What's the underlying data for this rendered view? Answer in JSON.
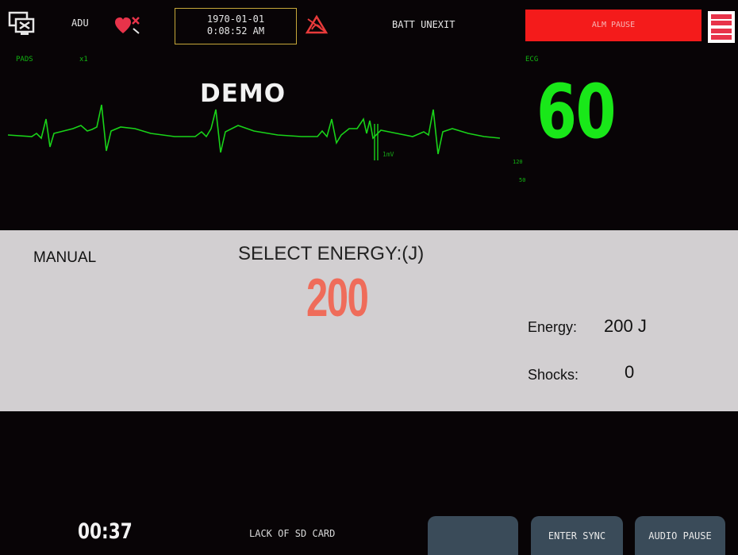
{
  "header": {
    "patient_type": "ADU",
    "date": "1970-01-01",
    "time": "0:08:52 AM",
    "battery_status": "BATT UNEXIT",
    "alarm_status": "ALM PAUSE",
    "icons": [
      "network-icon",
      "heart-pacer-icon",
      "alarm-off-icon",
      "menu-bar-icon"
    ]
  },
  "monitor": {
    "lead": "PADS",
    "gain": "x1",
    "mode_banner": "DEMO",
    "scale_label": "1mV",
    "ecg_label": "ECG",
    "heart_rate": "60",
    "hr_alarm_upper": "120",
    "hr_alarm_lower": "50",
    "colors": {
      "waveform": "#19d319",
      "heart_rate": "#19e819"
    }
  },
  "energy_panel": {
    "mode": "MANUAL",
    "prompt": "SELECT ENERGY:(J)",
    "selected_energy": "200",
    "energy_label": "Energy:",
    "energy_value": "200 J",
    "shocks_label": "Shocks:",
    "shocks_value": "0",
    "colors": {
      "panel": "#d2cfd1",
      "selected_energy": "#ef6c5a"
    }
  },
  "footer": {
    "elapsed_time": "00:37",
    "storage_status": "LACK OF SD CARD",
    "softkeys": [
      "",
      "ENTER SYNC",
      "AUDIO PAUSE"
    ]
  }
}
